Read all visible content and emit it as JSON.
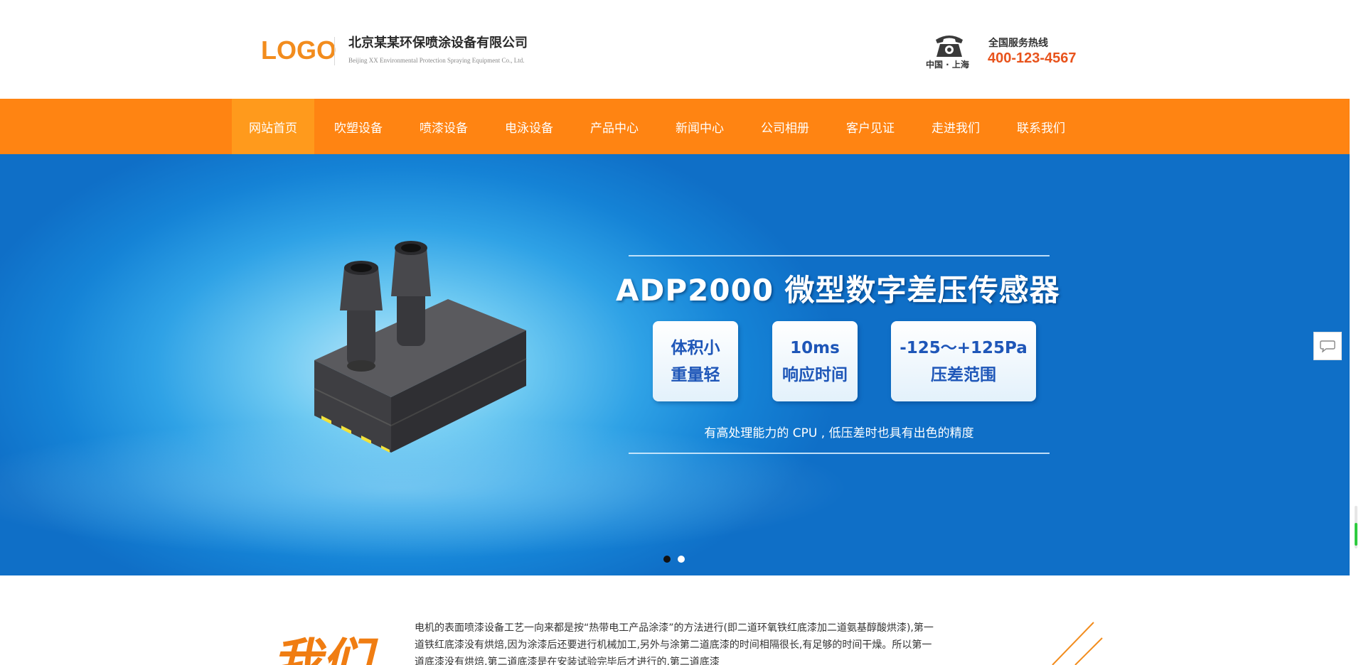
{
  "header": {
    "logo": "LOGO",
    "company_cn": "北京某某环保喷涂设备有限公司",
    "company_en": "Beijing XX Environmental Protection Spraying Equipment Co., Ltd.",
    "phone_sub": "中国 · 上海",
    "hotline_label": "全国服务热线",
    "hotline_number": "400-123-4567"
  },
  "nav": {
    "items": [
      {
        "label": "网站首页",
        "active": true
      },
      {
        "label": "吹塑设备"
      },
      {
        "label": "喷漆设备"
      },
      {
        "label": "电泳设备"
      },
      {
        "label": "产品中心"
      },
      {
        "label": "新闻中心"
      },
      {
        "label": "公司相册"
      },
      {
        "label": "客户见证"
      },
      {
        "label": "走进我们"
      },
      {
        "label": "联系我们"
      }
    ]
  },
  "banner": {
    "title": "ADP2000 微型数字差压传感器",
    "features": [
      {
        "line1": "体积小",
        "line2": "重量轻"
      },
      {
        "line1": "10ms",
        "line2": "响应时间"
      },
      {
        "line1": "-125～+125Pa",
        "line2": "压差范围"
      }
    ],
    "caption": "有高处理能力的 CPU , 低压差时也具有出色的精度",
    "slide_count": 2,
    "active_slide": 1
  },
  "about": {
    "heading": "我们",
    "text": "电机的表面喷漆设备工艺一向来都是按“热带电工产品涂漆”的方法进行(即二道环氧铁红底漆加二道氨基醇酸烘漆),第一道铁红底漆没有烘焙,因为涂漆后还要进行机械加工,另外与涂第二道底漆的时间相隔很长,有足够的时间干燥。所以第一道底漆没有烘焙,第二道底漆是在安装试验完毕后才进行的,第二道底漆"
  },
  "colors": {
    "accent": "#ff8412",
    "nav_active": "#ff9a1c",
    "hotline": "#e8531c",
    "feature_text": "#1e56b8"
  },
  "icons": {
    "phone": "telephone-icon",
    "chat": "chat-bubble-icon"
  }
}
